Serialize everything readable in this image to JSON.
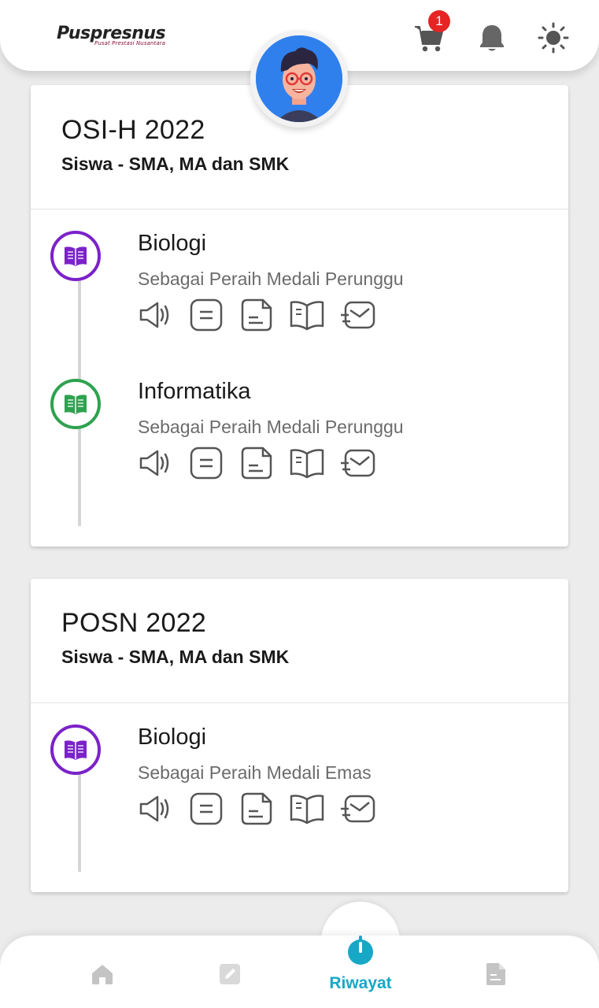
{
  "header": {
    "logo_text": "Puspresnus",
    "logo_subtext": "Pusat Prestasi Nusantara",
    "cart_badge": "1",
    "icons": [
      "cart-icon",
      "bell-icon",
      "sun-icon"
    ]
  },
  "cards": [
    {
      "title": "OSI-H 2022",
      "subtitle": "Siswa - SMA, MA dan SMK",
      "items": [
        {
          "name": "Biologi",
          "desc": "Sebagai Peraih Medali Perunggu",
          "color": "#7b22c9"
        },
        {
          "name": "Informatika",
          "desc": "Sebagai Peraih Medali Perunggu",
          "color": "#2ea24f"
        }
      ]
    },
    {
      "title": "POSN 2022",
      "subtitle": "Siswa - SMA, MA dan SMK",
      "items": [
        {
          "name": "Biologi",
          "desc": "Sebagai Peraih Medali Emas",
          "color": "#7b22c9"
        }
      ]
    }
  ],
  "action_icons": [
    "speaker-icon",
    "list-icon",
    "document-icon",
    "book-icon",
    "mail-icon"
  ],
  "bottom_nav": {
    "active_label": "Riwayat",
    "accent": "#17a7c7",
    "items": [
      "home-icon",
      "edit-icon",
      "history-icon",
      "file-icon"
    ]
  }
}
